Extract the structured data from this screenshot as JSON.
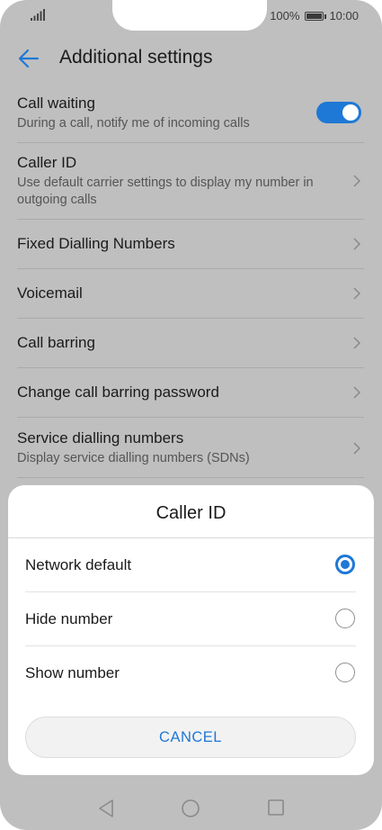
{
  "status_bar": {
    "battery_percent": "100%",
    "time": "10:00",
    "icons": [
      "signal-icon",
      "battery-icon"
    ]
  },
  "header": {
    "title": "Additional settings",
    "back_icon": "arrow-left-icon"
  },
  "settings": [
    {
      "label": "Call waiting",
      "sub": "During a call, notify me of incoming calls",
      "control": "toggle",
      "toggle_on": true
    },
    {
      "label": "Caller ID",
      "sub": "Use default carrier settings to display my number in outgoing calls",
      "control": "chevron"
    },
    {
      "label": "Fixed Dialling Numbers",
      "sub": "",
      "control": "chevron"
    },
    {
      "label": "Voicemail",
      "sub": "",
      "control": "chevron"
    },
    {
      "label": "Call barring",
      "sub": "",
      "control": "chevron"
    },
    {
      "label": "Change call barring password",
      "sub": "",
      "control": "chevron"
    },
    {
      "label": "Service dialling numbers",
      "sub": "Display service dialling numbers (SDNs)",
      "control": "chevron"
    }
  ],
  "dialog": {
    "title": "Caller ID",
    "options": [
      {
        "label": "Network default",
        "selected": true
      },
      {
        "label": "Hide number",
        "selected": false
      },
      {
        "label": "Show number",
        "selected": false
      }
    ],
    "cancel_label": "CANCEL"
  },
  "nav_bar": {
    "icons": [
      "back-triangle-icon",
      "home-circle-icon",
      "recents-square-icon"
    ]
  },
  "colors": {
    "accent": "#1e78d6",
    "dim_background": "#bfbfbf",
    "sheet": "#ffffff"
  }
}
